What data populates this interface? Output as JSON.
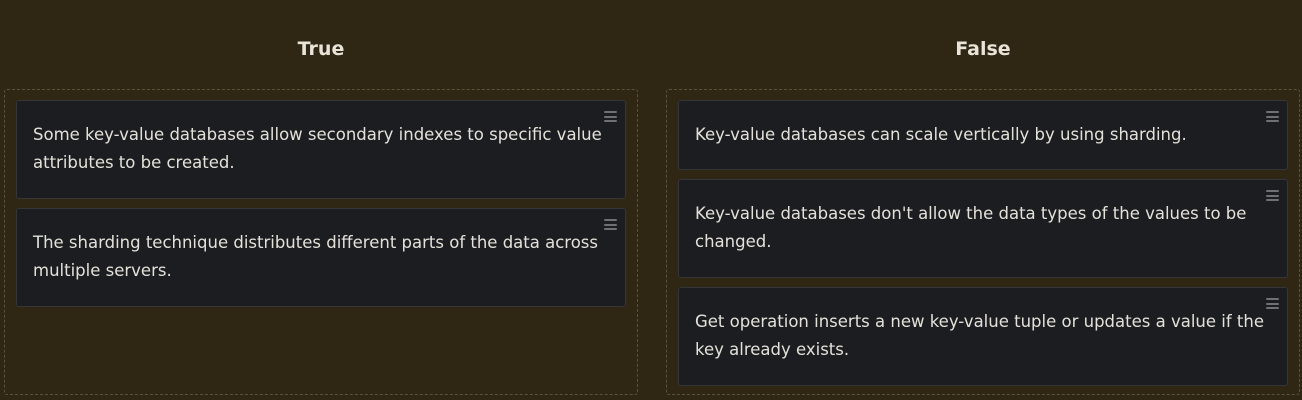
{
  "columns": {
    "true": {
      "title": "True",
      "cards": [
        {
          "text": "Some key-value databases allow secondary indexes to specific value attributes to be created."
        },
        {
          "text": "The sharding technique distributes different parts of the data across multiple servers."
        }
      ]
    },
    "false": {
      "title": "False",
      "cards": [
        {
          "text": "Key-value databases can scale vertically by using sharding."
        },
        {
          "text": "Key-value databases don't allow the data types of the values to be changed."
        },
        {
          "text": "Get operation inserts a new key-value tuple or updates a value if the key already exists."
        }
      ]
    }
  },
  "icons": {
    "drag_handle": "drag-handle-icon"
  },
  "colors": {
    "background": "#2f2714",
    "card": "#1c1d20",
    "dropzone_border": "#5d5237",
    "text": "#e4e1da"
  }
}
